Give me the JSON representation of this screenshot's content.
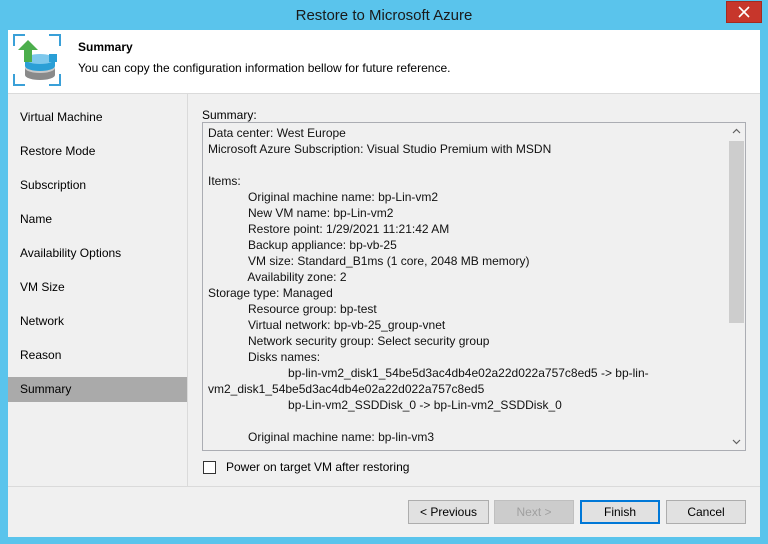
{
  "window": {
    "title": "Restore to Microsoft Azure"
  },
  "header": {
    "title": "Summary",
    "subtitle": "You can copy the configuration information bellow for future reference."
  },
  "nav": {
    "items": [
      {
        "label": "Virtual Machine"
      },
      {
        "label": "Restore Mode"
      },
      {
        "label": "Subscription"
      },
      {
        "label": "Name"
      },
      {
        "label": "Availability Options"
      },
      {
        "label": "VM Size"
      },
      {
        "label": "Network"
      },
      {
        "label": "Reason"
      },
      {
        "label": "Summary",
        "active": true
      }
    ]
  },
  "summary": {
    "label": "Summary:",
    "lines": [
      "Data center: West Europe",
      "Microsoft Azure Subscription: Visual Studio Premium with MSDN",
      "",
      "Items:",
      "            Original machine name: bp-Lin-vm2",
      "            New VM name: bp-Lin-vm2",
      "            Restore point: 1/29/2021 11:21:42 AM",
      "            Backup appliance: bp-vb-25",
      "            VM size: Standard_B1ms (1 core, 2048 MB memory)",
      "            Availability zone: 2",
      "Storage type: Managed",
      "            Resource group: bp-test",
      "            Virtual network: bp-vb-25_group-vnet",
      "            Network security group: Select security group",
      "            Disks names:",
      "                        bp-lin-vm2_disk1_54be5d3ac4db4e02a22d022a757c8ed5 -> bp-lin-",
      "vm2_disk1_54be5d3ac4db4e02a22d022a757c8ed5",
      "                        bp-Lin-vm2_SSDDisk_0 -> bp-Lin-vm2_SSDDisk_0",
      "",
      "            Original machine name: bp-lin-vm3"
    ]
  },
  "options": {
    "power_on_label": "Power on target VM after restoring",
    "power_on_checked": false
  },
  "buttons": {
    "previous": "< Previous",
    "next": "Next >",
    "finish": "Finish",
    "cancel": "Cancel"
  },
  "icons": {
    "close": "close-icon",
    "header": "restore-vm-icon",
    "scroll_up": "scroll-up-arrow-icon",
    "scroll_down": "scroll-down-arrow-icon"
  }
}
